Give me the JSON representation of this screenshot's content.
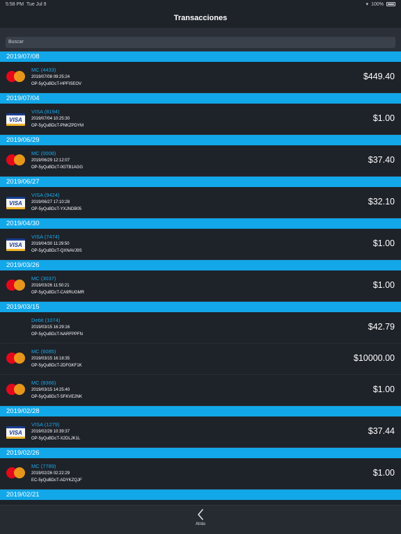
{
  "status_bar": {
    "time": "5:58 PM",
    "date": "Tue Jul 9",
    "battery": "100%"
  },
  "nav": {
    "title": "Transacciones"
  },
  "search": {
    "placeholder": "Buscar"
  },
  "groups": [
    {
      "date": "2019/07/08",
      "items": [
        {
          "type": "mc",
          "card": "MC (4433)",
          "datetime": "2019/07/08 09:25:24",
          "ref": "OP-5yQuBDcT-HPFISEOV",
          "amount": "$449.40"
        }
      ]
    },
    {
      "date": "2019/07/04",
      "items": [
        {
          "type": "visa",
          "card": "VISA (8194)",
          "datetime": "2019/07/04 10:25:30",
          "ref": "OP-5yQuBDcT-PNKZPDYM",
          "amount": "$1.00"
        }
      ]
    },
    {
      "date": "2019/06/29",
      "items": [
        {
          "type": "mc",
          "card": "MC (0008)",
          "datetime": "2019/06/29 12:12:07",
          "ref": "OP-5yQuBDcT-0GTB1AGG",
          "amount": "$37.40"
        }
      ]
    },
    {
      "date": "2019/06/27",
      "items": [
        {
          "type": "visa",
          "card": "VISA (9424)",
          "datetime": "2019/06/27 17:10:28",
          "ref": "OP-5yQuBDcT-YXJNDB05",
          "amount": "$32.10"
        }
      ]
    },
    {
      "date": "2019/04/30",
      "items": [
        {
          "type": "visa",
          "card": "VISA (7474)",
          "datetime": "2019/04/30 11:29:50",
          "ref": "OP-5yQuBDcT-QXNAVJ9S",
          "amount": "$1.00"
        }
      ]
    },
    {
      "date": "2019/03/26",
      "items": [
        {
          "type": "mc",
          "card": "MC (3037)",
          "datetime": "2019/03/26 11:50:21",
          "ref": "OP-5yQuBDcT-CA9RUGMR",
          "amount": "$1.00"
        }
      ]
    },
    {
      "date": "2019/03/15",
      "items": [
        {
          "type": "none",
          "card": "Debit (1074)",
          "datetime": "2019/03/15 16:29:16",
          "ref": "OP-5yQuBDcT-NARFPPFN",
          "amount": "$42.79"
        },
        {
          "type": "mc",
          "card": "MC (6085)",
          "datetime": "2019/03/15 16:18:35",
          "ref": "OP-5yQuBDcT-2DFGKF1K",
          "amount": "$10000.00"
        },
        {
          "type": "mc",
          "card": "MC (8366)",
          "datetime": "2019/03/15 14:25:40",
          "ref": "OP-5yQuBDcT-SFKVE2NK",
          "amount": "$1.00"
        }
      ]
    },
    {
      "date": "2019/02/28",
      "items": [
        {
          "type": "visa",
          "card": "VISA (1279)",
          "datetime": "2019/02/28 10:39:37",
          "ref": "OP-5yQuBDcT-X2DLJK1L",
          "amount": "$37.44"
        }
      ]
    },
    {
      "date": "2019/02/26",
      "items": [
        {
          "type": "mc",
          "card": "MC (7789)",
          "datetime": "2019/02/26 02:22:29",
          "ref": "EC-5yQuBDcT-ADYKZQJF",
          "amount": "$1.00"
        }
      ]
    },
    {
      "date": "2019/02/21",
      "items": []
    }
  ],
  "icons": {
    "mc": "mastercard-icon",
    "visa": "visa-icon",
    "back": "chevron-left-icon"
  },
  "visa_logo_text": "VISA",
  "bottom": {
    "back_label": "Atrás"
  },
  "colors": {
    "accent": "#12a7e8",
    "background": "#1e2229",
    "link": "#1aa8e8"
  }
}
